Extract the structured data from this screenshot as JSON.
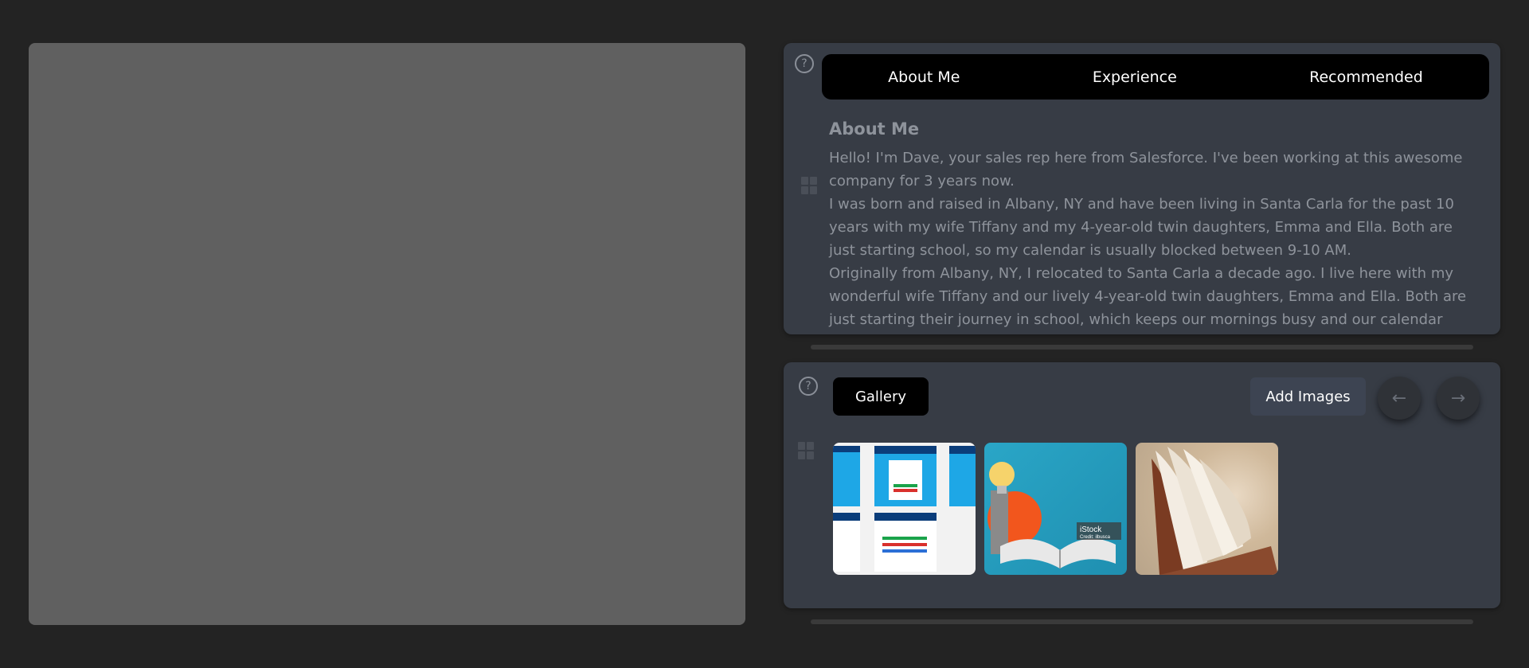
{
  "about": {
    "tabs": [
      "About Me",
      "Experience",
      "Recommended"
    ],
    "title": "About Me",
    "paragraphs": [
      "Hello! I'm Dave, your sales rep here from Salesforce. I've been working at this awesome company for 3 years now.",
      "I was born and raised in Albany, NY and have been living in Santa Carla for the past 10 years with my wife Tiffany and my 4-year-old twin daughters, Emma and Ella. Both are just starting school, so my calendar is usually blocked between 9-10 AM.",
      "Originally from Albany, NY, I relocated to Santa Carla a decade ago. I live here with my wonderful wife Tiffany and our lively 4-year-old twin daughters, Emma and Ella. Both are just starting their journey in school, which keeps our mornings busy and our calendar packed from"
    ]
  },
  "gallery": {
    "title": "Gallery",
    "add_label": "Add Images",
    "prev_icon": "←",
    "next_icon": "→",
    "thumb2_watermark": "iStock",
    "thumb2_credit": "Credit: ilbusca"
  },
  "icons": {
    "help": "?"
  },
  "colors": {
    "background": "#232323",
    "card": "#373c45",
    "placeholder": "#606060",
    "tab_bar": "#000000",
    "add_button": "#3d4452"
  }
}
